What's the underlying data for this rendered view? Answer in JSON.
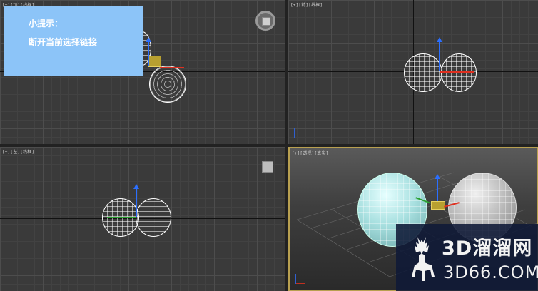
{
  "viewports": {
    "top": {
      "label": "[+][顶][线框]"
    },
    "front": {
      "label": "[+][前][线框]"
    },
    "left": {
      "label": "[+][左][线框]"
    },
    "perspective": {
      "label": "[+][透视][真实]"
    }
  },
  "tip": {
    "title": "小提示：",
    "text": "断开当前选择链接"
  },
  "watermark": {
    "brand": "3D溜溜网",
    "domain": "3D66.COM"
  },
  "colors": {
    "tip_background": "#8cc4f8",
    "active_viewport_border": "#b8a050",
    "axis_x": "#e03020",
    "axis_y": "#2b6fff",
    "axis_z": "#2aa030",
    "watermark_background": "#0f1937"
  },
  "icons": {
    "view_cube": "view-cube-icon",
    "view_cube_small": "view-cube-small-icon",
    "watermark_logo": "deer-logo-icon"
  }
}
